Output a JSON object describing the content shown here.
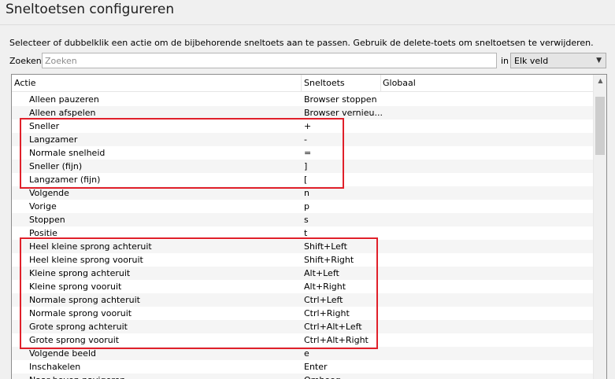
{
  "page": {
    "title": "Sneltoetsen configureren",
    "instruction": "Selecteer of dubbelklik een actie om de bijbehorende sneltoets aan te passen. Gebruik de delete-toets om sneltoetsen te verwijderen."
  },
  "search": {
    "label": "Zoeken",
    "placeholder": "Zoeken",
    "in_label": "in",
    "scope": "Elk veld"
  },
  "table": {
    "columns": [
      "Actie",
      "Sneltoets",
      "Globaal"
    ],
    "rows": [
      {
        "action": "Alleen pauzeren",
        "shortcut": "Browser stoppen"
      },
      {
        "action": "Alleen afspelen",
        "shortcut": "Browser vernieu..."
      },
      {
        "action": "Sneller",
        "shortcut": "+"
      },
      {
        "action": "Langzamer",
        "shortcut": "-"
      },
      {
        "action": "Normale snelheid",
        "shortcut": "="
      },
      {
        "action": "Sneller (fijn)",
        "shortcut": "]"
      },
      {
        "action": "Langzamer (fijn)",
        "shortcut": "["
      },
      {
        "action": "Volgende",
        "shortcut": "n"
      },
      {
        "action": "Vorige",
        "shortcut": "p"
      },
      {
        "action": "Stoppen",
        "shortcut": "s"
      },
      {
        "action": "Positie",
        "shortcut": "t"
      },
      {
        "action": "Heel kleine sprong achteruit",
        "shortcut": "Shift+Left"
      },
      {
        "action": "Heel kleine sprong vooruit",
        "shortcut": "Shift+Right"
      },
      {
        "action": "Kleine sprong achteruit",
        "shortcut": "Alt+Left"
      },
      {
        "action": "Kleine sprong vooruit",
        "shortcut": "Alt+Right"
      },
      {
        "action": "Normale sprong achteruit",
        "shortcut": "Ctrl+Left"
      },
      {
        "action": "Normale sprong vooruit",
        "shortcut": "Ctrl+Right"
      },
      {
        "action": "Grote sprong achteruit",
        "shortcut": "Ctrl+Alt+Left"
      },
      {
        "action": "Grote sprong vooruit",
        "shortcut": "Ctrl+Alt+Right"
      },
      {
        "action": "Volgende beeld",
        "shortcut": "e"
      },
      {
        "action": "Inschakelen",
        "shortcut": "Enter"
      },
      {
        "action": "Naar boven navigeren",
        "shortcut": "Omhoog"
      }
    ]
  },
  "colors": {
    "highlight": "#e0202a"
  }
}
